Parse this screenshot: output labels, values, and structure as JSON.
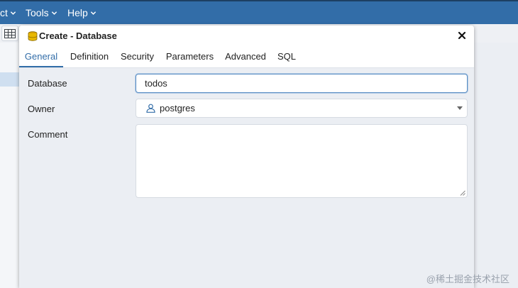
{
  "menu": {
    "items": [
      {
        "label": "ct"
      },
      {
        "label": "Tools"
      },
      {
        "label": "Help"
      }
    ]
  },
  "dialog": {
    "title": "Create - Database",
    "icon": "database-icon",
    "tabs": [
      {
        "label": "General",
        "active": true
      },
      {
        "label": "Definition",
        "active": false
      },
      {
        "label": "Security",
        "active": false
      },
      {
        "label": "Parameters",
        "active": false
      },
      {
        "label": "Advanced",
        "active": false
      },
      {
        "label": "SQL",
        "active": false
      }
    ],
    "form": {
      "database_label": "Database",
      "database_value": "todos",
      "owner_label": "Owner",
      "owner_value": "postgres",
      "owner_icon": "user-icon",
      "comment_label": "Comment",
      "comment_value": ""
    }
  },
  "watermark": "@稀土掘金技术社区",
  "colors": {
    "menubar": "#326da8",
    "accent": "#326da8",
    "dialog_bg": "#ebeef3"
  }
}
